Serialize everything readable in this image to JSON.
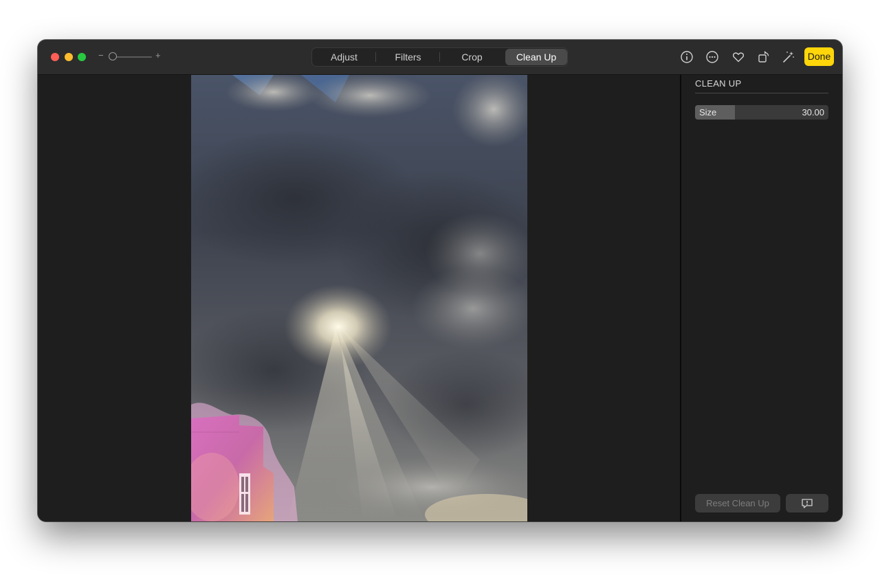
{
  "toolbar": {
    "zoom_minus": "−",
    "zoom_plus": "+",
    "zoom_level": 0.0,
    "tabs": [
      {
        "label": "Adjust",
        "active": false
      },
      {
        "label": "Filters",
        "active": false
      },
      {
        "label": "Crop",
        "active": false
      },
      {
        "label": "Clean Up",
        "active": true
      }
    ],
    "icons": [
      "info-icon",
      "more-icon",
      "heart-icon",
      "rotate-icon",
      "magic-wand-icon"
    ],
    "done_label": "Done",
    "accent_color": "#ffd60a"
  },
  "sidebar": {
    "title": "CLEAN UP",
    "size": {
      "label": "Size",
      "value": "30.00",
      "level": 0.3
    },
    "reset_label": "Reset Clean Up",
    "feedback_icon": "feedback-icon"
  },
  "photo": {
    "description_icon": "photo-canvas",
    "highlight_color": "#e06bb0"
  }
}
